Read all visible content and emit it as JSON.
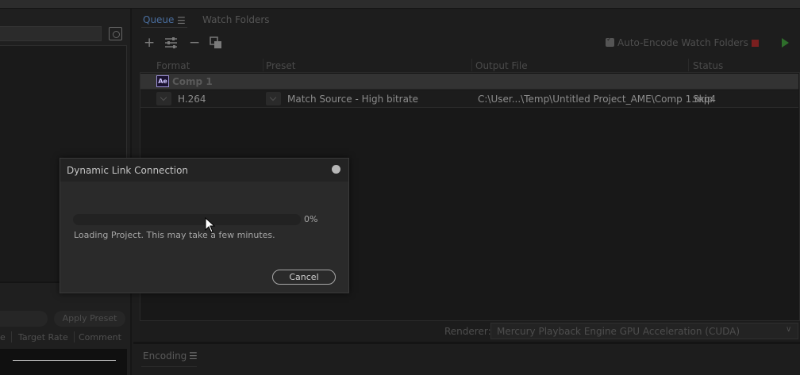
{
  "queue_panel": {
    "tabs": [
      {
        "label": "Queue",
        "active": true
      },
      {
        "label": "Watch Folders",
        "active": false
      }
    ],
    "tab_menu_icon": "hamburger-icon",
    "toolbar": {
      "icons": [
        "add-icon",
        "settings-sliders-icon",
        "remove-icon",
        "duplicate-icon"
      ],
      "auto_encode_label": "Auto-Encode Watch Folders",
      "auto_encode_checked": true,
      "stop_icon": "stop-square-icon",
      "start_icon": "play-triangle-icon"
    },
    "columns": [
      "Format",
      "Preset",
      "Output File",
      "Status"
    ],
    "group": {
      "app_badge": "Ae",
      "name": "Comp 1"
    },
    "items": [
      {
        "format": "H.264",
        "preset": "Match Source - High bitrate",
        "output_file": "C:\\User...\\Temp\\Untitled Project_AME\\Comp 1.mp4",
        "status": "Skip"
      }
    ],
    "renderer_label": "Renderer:",
    "renderer_value": "Mercury Playback Engine GPU Acceleration (CUDA)"
  },
  "left_panel": {
    "apply_preset_label": "Apply Preset",
    "columns": [
      "e",
      "Target Rate",
      "Comment"
    ]
  },
  "encoding_panel": {
    "label": "Encoding"
  },
  "dialog": {
    "title": "Dynamic Link Connection",
    "progress_percent": 0,
    "progress_label": "0%",
    "message": "Loading Project. This may take a few minutes.",
    "cancel_label": "Cancel"
  },
  "colors": {
    "accent_tab": "#4a6fa0",
    "stop": "#7a1f1f",
    "start": "#2e6e2b",
    "ae_badge": "#9a8fd3"
  }
}
